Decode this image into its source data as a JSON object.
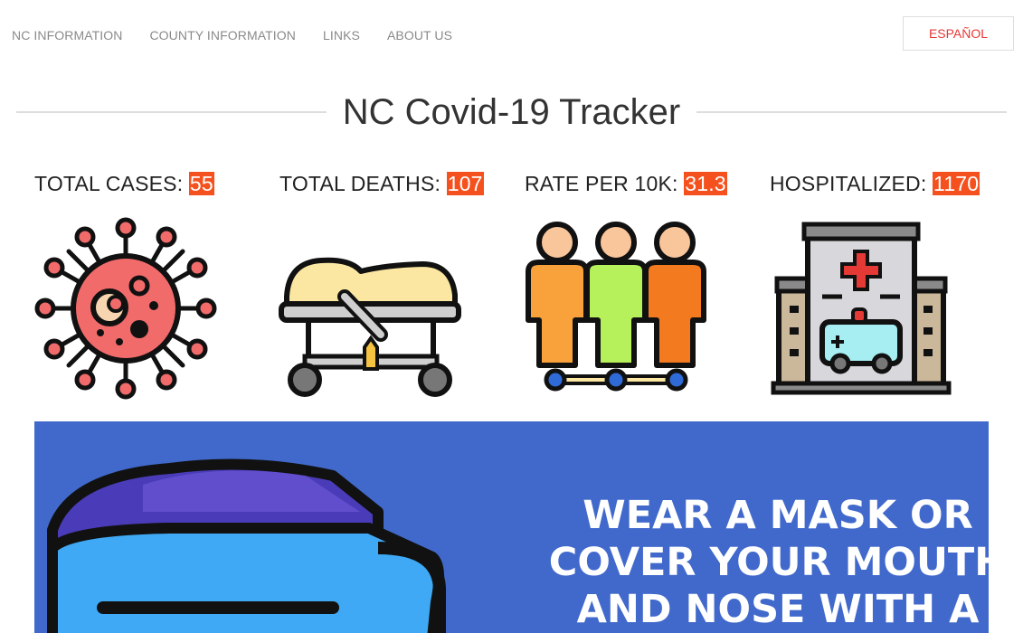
{
  "nav": {
    "items": [
      {
        "label": "NC INFORMATION"
      },
      {
        "label": "COUNTY INFORMATION"
      },
      {
        "label": "LINKS"
      },
      {
        "label": "ABOUT US"
      }
    ],
    "language_button": "ESPAÑOL"
  },
  "title": "NC Covid-19 Tracker",
  "stats": [
    {
      "label": "TOTAL CASES: ",
      "value": "55",
      "icon": "virus-icon"
    },
    {
      "label": "TOTAL DEATHS: ",
      "value": "107",
      "icon": "stretcher-icon"
    },
    {
      "label": "RATE PER 10K: ",
      "value": "31.3",
      "icon": "people-icon"
    },
    {
      "label": "HOSPITALIZED: ",
      "value": "1170",
      "icon": "hospital-icon"
    }
  ],
  "banner": {
    "lines": [
      "WEAR A MASK OR",
      "COVER YOUR MOUTH",
      "AND NOSE WITH A"
    ],
    "background": "#4169cc"
  },
  "colors": {
    "accent": "#f4511e",
    "language_text": "#e53935"
  }
}
